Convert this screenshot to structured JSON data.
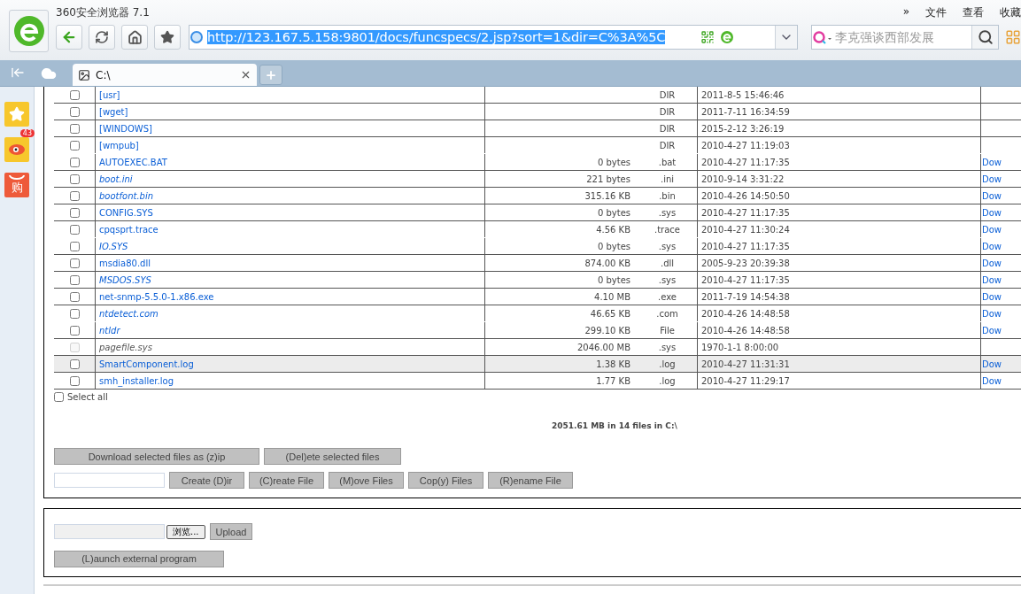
{
  "browser": {
    "title": "360安全浏览器 7.1",
    "menu": [
      "»",
      "文件",
      "查看",
      "收藏"
    ],
    "address": "http://123.167.5.158:9801/docs/funcspecs/2.jsp?sort=1&dir=C%3A%5C",
    "search_placeholder": "李克强谈西部发展"
  },
  "tabs": [
    {
      "label": "C:\\",
      "selected": true
    }
  ],
  "sidebar": {
    "badge": "43",
    "shop_label": "购"
  },
  "table": {
    "row_groups": [
      [
        {
          "name": "[usr]",
          "date": "2011-8-5 15:46:46",
          "ext": "DIR",
          "checked": false
        }
      ],
      [
        {
          "name": "[wget]",
          "date": "2011-7-11 16:34:59",
          "ext": "DIR",
          "checked": false
        }
      ],
      [
        {
          "name": "[WINDOWS]",
          "date": "2015-2-12 3:26:19",
          "ext": "DIR",
          "checked": false
        }
      ],
      [
        {
          "name": "[wmpub]",
          "date": "2010-4-27 11:19:03",
          "ext": "DIR",
          "checked": false
        },
        {
          "name": "AUTOEXEC.BAT",
          "size": "0 bytes",
          "ext": ".bat",
          "date": "2010-4-27 11:17:35",
          "download": "Dow",
          "checked": false
        }
      ],
      [
        {
          "name": "boot.ini",
          "size": "221 bytes",
          "ext": ".ini",
          "date": "2010-9-14 3:31:22",
          "download": "Dow",
          "hidden": true,
          "checked": false
        }
      ],
      [
        {
          "name": "bootfont.bin",
          "size": "315.16 KB",
          "ext": ".bin",
          "date": "2010-4-26 14:50:50",
          "download": "Dow",
          "hidden": true,
          "checked": false
        }
      ],
      [
        {
          "name": "CONFIG.SYS",
          "size": "0 bytes",
          "ext": ".sys",
          "date": "2010-4-27 11:17:35",
          "download": "Dow",
          "checked": false
        }
      ],
      [
        {
          "name": "cpqsprt.trace",
          "size": "4.56 KB",
          "ext": ".trace",
          "date": "2010-4-27 11:30:24",
          "download": "Dow",
          "checked": false
        },
        {
          "name": "IO.SYS",
          "size": "0 bytes",
          "ext": ".sys",
          "date": "2010-4-27 11:17:35",
          "download": "Dow",
          "hidden": true,
          "checked": false
        }
      ],
      [
        {
          "name": "msdia80.dll",
          "size": "874.00 KB",
          "ext": ".dll",
          "date": "2005-9-23 20:39:38",
          "download": "Dow",
          "checked": false
        }
      ],
      [
        {
          "name": "MSDOS.SYS",
          "size": "0 bytes",
          "ext": ".sys",
          "date": "2010-4-27 11:17:35",
          "download": "Dow",
          "hidden": true,
          "checked": false
        }
      ],
      [
        {
          "name": "net-snmp-5.5.0-1.x86.exe",
          "size": "4.10 MB",
          "ext": ".exe",
          "date": "2011-7-19 14:54:38",
          "download": "Dow",
          "checked": false
        }
      ],
      [
        {
          "name": "ntdetect.com",
          "size": "46.65 KB",
          "ext": ".com",
          "date": "2010-4-26 14:48:58",
          "download": "Dow",
          "hidden": true,
          "checked": false
        },
        {
          "name": "ntldr",
          "size": "299.10 KB",
          "ext": "File",
          "date": "2010-4-26 14:48:58",
          "download": "Dow",
          "hidden": true,
          "checked": false
        }
      ],
      [
        {
          "name": "pagefile.sys",
          "size": "2046.00 MB",
          "ext": ".sys",
          "date": "1970-1-1 8:00:00",
          "hidden": true,
          "disabled": true,
          "checked": false
        }
      ],
      [
        {
          "name": "SmartComponent.log",
          "size": "1.38 KB",
          "ext": ".log",
          "date": "2010-4-27 11:31:31",
          "download": "Dow",
          "highlighted": true,
          "checked": false
        }
      ],
      [
        {
          "name": "smh_installer.log",
          "size": "1.77 KB",
          "ext": ".log",
          "date": "2010-4-27 11:29:17",
          "download": "Dow",
          "checked": false
        }
      ]
    ]
  },
  "select_all": {
    "label": "Select all",
    "checked": false
  },
  "summary": "2051.61 MB in 14 files in C:\\",
  "actions": [
    "Download selected files as (z)ip",
    "(Del)ete selected files"
  ],
  "file_actions": [
    "Create (D)ir",
    "(C)reate File",
    "(M)ove Files",
    "Cop(y) Files",
    "(R)ename File"
  ],
  "upload": {
    "browse": "浏览...",
    "button": "Upload"
  },
  "launch": "(L)aunch external program"
}
